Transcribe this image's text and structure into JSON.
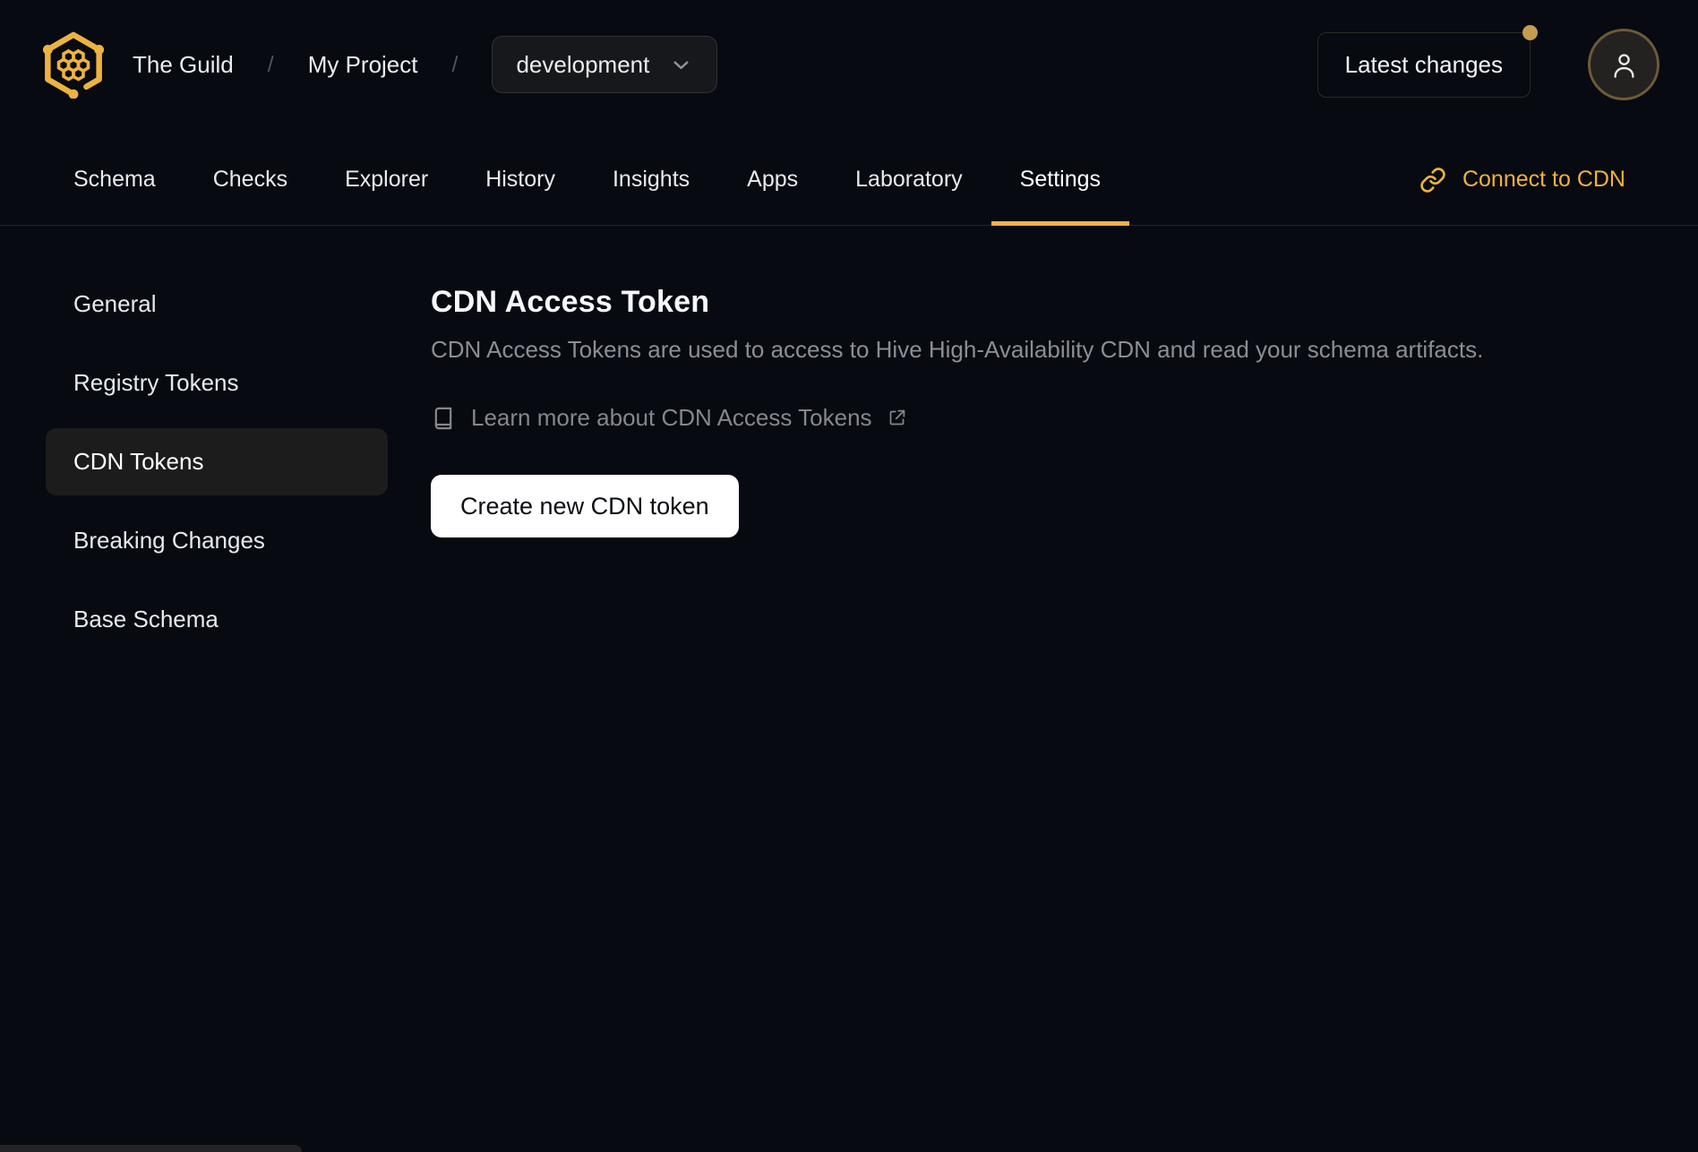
{
  "header": {
    "breadcrumb": {
      "org": "The Guild",
      "separator": "/",
      "project": "My Project"
    },
    "target_dropdown": {
      "selected": "development"
    },
    "latest_changes_label": "Latest changes"
  },
  "nav": {
    "tabs": [
      "Schema",
      "Checks",
      "Explorer",
      "History",
      "Insights",
      "Apps",
      "Laboratory",
      "Settings"
    ],
    "active_tab": "Settings",
    "connect_cdn_label": "Connect to CDN"
  },
  "sidebar": {
    "items": [
      "General",
      "Registry Tokens",
      "CDN Tokens",
      "Breaking Changes",
      "Base Schema"
    ],
    "active_item": "CDN Tokens"
  },
  "main": {
    "title": "CDN Access Token",
    "description": "CDN Access Tokens are used to access to Hive High-Availability CDN and read your schema artifacts.",
    "learn_more_label": "Learn more about CDN Access Tokens",
    "create_button_label": "Create new CDN token"
  },
  "icons": {
    "logo": "hive-honeycomb-logo",
    "chevron": "chevron-down-icon",
    "user": "user-icon",
    "link": "chain-link-icon",
    "book": "book-icon",
    "external": "external-link-icon"
  },
  "colors": {
    "background": "#070a11",
    "accent_gold": "#f0b13e",
    "active_tab_underline": "#eeb24a",
    "notification_dot": "#c49c51",
    "active_sidebar_item_bg": "#1c1c1c",
    "create_button_bg": "#ffffff",
    "muted_text": "#8b8e93"
  }
}
